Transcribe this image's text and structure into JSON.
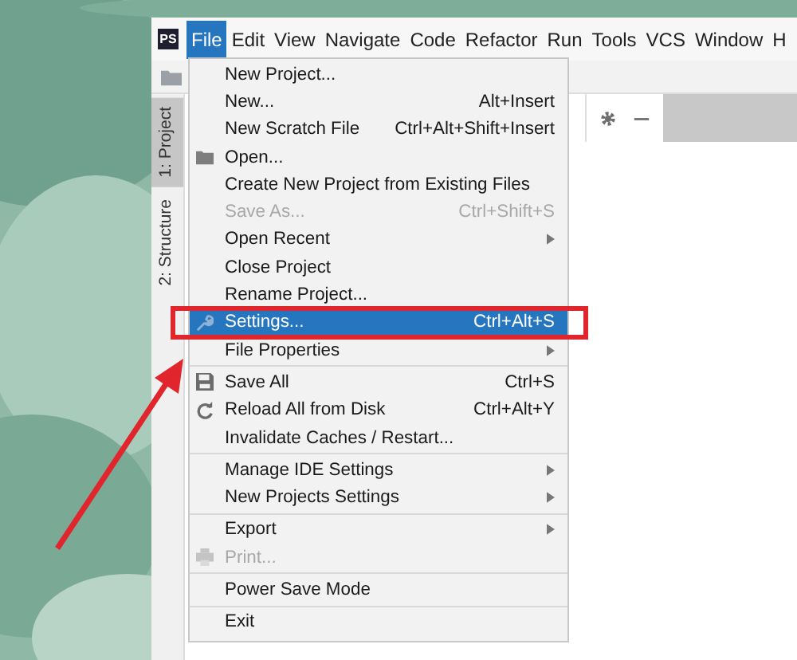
{
  "app_logo": "PS",
  "menu_bar": [
    {
      "label": "File",
      "selected": true
    },
    {
      "label": "Edit",
      "selected": false
    },
    {
      "label": "View",
      "selected": false
    },
    {
      "label": "Navigate",
      "selected": false
    },
    {
      "label": "Code",
      "selected": false
    },
    {
      "label": "Refactor",
      "selected": false
    },
    {
      "label": "Run",
      "selected": false
    },
    {
      "label": "Tools",
      "selected": false
    },
    {
      "label": "VCS",
      "selected": false
    },
    {
      "label": "Window",
      "selected": false
    },
    {
      "label": "H",
      "selected": false
    }
  ],
  "tool_strip": [
    {
      "label": "1: Project",
      "selected": true
    },
    {
      "label": "2: Structure",
      "selected": false
    }
  ],
  "file_menu": {
    "sections": [
      {
        "items": [
          {
            "label": "New Project...",
            "kind": "plain",
            "selected": false,
            "disabled": false,
            "submenu": false
          },
          {
            "label": "New...",
            "shortcut": "Alt+Insert",
            "kind": "plain",
            "selected": false,
            "disabled": false,
            "submenu": false
          },
          {
            "label": "New Scratch File",
            "shortcut": "Ctrl+Alt+Shift+Insert",
            "kind": "plain",
            "selected": false,
            "disabled": false,
            "submenu": false
          },
          {
            "label": "Open...",
            "kind": "folder",
            "selected": false,
            "disabled": false,
            "submenu": false
          },
          {
            "label": "Create New Project from Existing Files",
            "kind": "plain",
            "selected": false,
            "disabled": false,
            "submenu": false
          },
          {
            "label": "Save As...",
            "shortcut": "Ctrl+Shift+S",
            "kind": "plain",
            "selected": false,
            "disabled": true,
            "submenu": false
          },
          {
            "label": "Open Recent",
            "kind": "plain",
            "selected": false,
            "disabled": false,
            "submenu": true
          },
          {
            "label": "Close Project",
            "kind": "plain",
            "selected": false,
            "disabled": false,
            "submenu": false
          },
          {
            "label": "Rename Project...",
            "kind": "plain",
            "selected": false,
            "disabled": false,
            "submenu": false
          },
          {
            "label": "Settings...",
            "shortcut": "Ctrl+Alt+S",
            "kind": "wrench",
            "selected": true,
            "disabled": false,
            "submenu": false
          },
          {
            "label": "File Properties",
            "kind": "plain",
            "selected": false,
            "disabled": false,
            "submenu": true
          }
        ]
      },
      {
        "items": [
          {
            "label": "Save All",
            "shortcut": "Ctrl+S",
            "kind": "save",
            "selected": false,
            "disabled": false,
            "submenu": false
          },
          {
            "label": "Reload All from Disk",
            "shortcut": "Ctrl+Alt+Y",
            "kind": "reload",
            "selected": false,
            "disabled": false,
            "submenu": false
          },
          {
            "label": "Invalidate Caches / Restart...",
            "kind": "plain",
            "selected": false,
            "disabled": false,
            "submenu": false
          }
        ]
      },
      {
        "items": [
          {
            "label": "Manage IDE Settings",
            "kind": "plain",
            "selected": false,
            "disabled": false,
            "submenu": true
          },
          {
            "label": "New Projects Settings",
            "kind": "plain",
            "selected": false,
            "disabled": false,
            "submenu": true
          }
        ]
      },
      {
        "items": [
          {
            "label": "Export",
            "kind": "plain",
            "selected": false,
            "disabled": false,
            "submenu": true
          },
          {
            "label": "Print...",
            "kind": "print",
            "selected": false,
            "disabled": true,
            "submenu": false
          }
        ]
      },
      {
        "items": [
          {
            "label": "Power Save Mode",
            "kind": "plain",
            "selected": false,
            "disabled": false,
            "submenu": false
          }
        ]
      },
      {
        "items": [
          {
            "label": "Exit",
            "kind": "plain",
            "selected": false,
            "disabled": false,
            "submenu": false
          }
        ]
      }
    ]
  }
}
